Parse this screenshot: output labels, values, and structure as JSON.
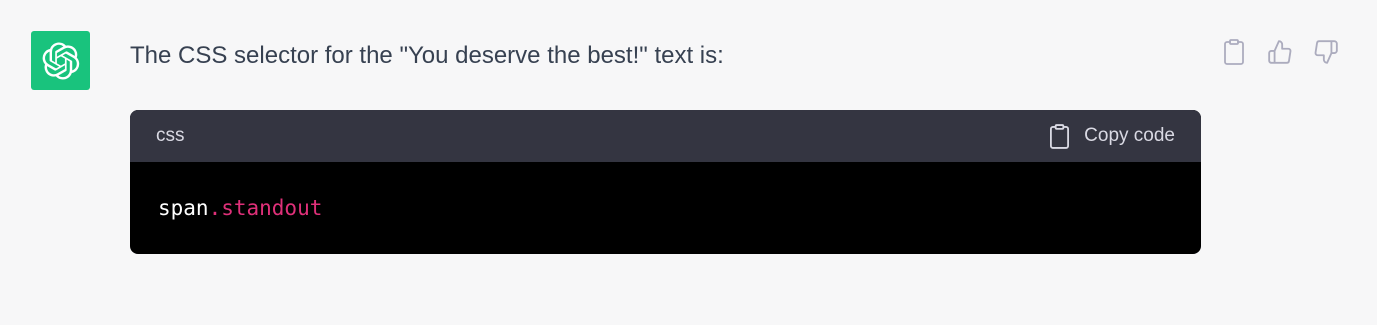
{
  "message": {
    "text": "The CSS selector for the \"You deserve the best!\" text is:"
  },
  "avatar": {
    "icon": "openai-logo-icon",
    "color": "#19c37d"
  },
  "actions": {
    "copy_icon": "clipboard-icon",
    "like_icon": "thumbs-up-icon",
    "dislike_icon": "thumbs-down-icon"
  },
  "code_block": {
    "language": "css",
    "copy_label": "Copy code",
    "copy_icon": "clipboard-icon",
    "code_tag": "span",
    "code_class": ".standout",
    "tag_color": "#ffffff",
    "class_color": "#df3079",
    "header_bg": "#343541",
    "body_bg": "#000000"
  }
}
